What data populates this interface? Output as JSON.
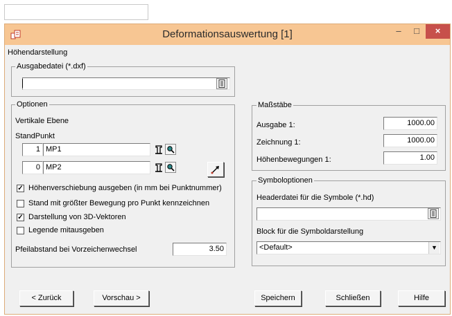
{
  "window": {
    "title": "Deformationsauswertung [1]",
    "subtitle": "Höhendarstellung",
    "accent_color": "#f7c693",
    "close_color": "#c7504b"
  },
  "output_file": {
    "legend": "Ausgabedatei (*.dxf)",
    "value": ""
  },
  "options": {
    "legend": "Optionen",
    "plane_label": "Vertikale Ebene",
    "standpoint_label": "StandPunkt",
    "points": [
      {
        "number": "1",
        "name": "MP1"
      },
      {
        "number": "0",
        "name": "MP2"
      }
    ],
    "checkboxes": [
      {
        "label": "Höhenverschiebung ausgeben (in mm bei Punktnummer)",
        "checked": true
      },
      {
        "label": "Stand mit größter Bewegung pro Punkt kennzeichnen",
        "checked": false
      },
      {
        "label": "Darstellung von 3D-Vektoren",
        "checked": true
      },
      {
        "label": "Legende mitausgeben",
        "checked": false
      }
    ],
    "arrow_label": "Pfeilabstand bei Vorzeichenwechsel",
    "arrow_value": "3.50"
  },
  "scales": {
    "legend": "Maßstäbe",
    "rows": [
      {
        "label": "Ausgabe 1:",
        "value": "1000.00"
      },
      {
        "label": "Zeichnung 1:",
        "value": "1000.00"
      },
      {
        "label": "Höhenbewegungen 1:",
        "value": "1.00"
      }
    ]
  },
  "symbols": {
    "legend": "Symboloptionen",
    "header_label": "Headerdatei für die Symbole (*.hd)",
    "header_value": "",
    "block_label": "Block für die Symboldarstellung",
    "block_value": "<Default>"
  },
  "buttons": {
    "back": "< Zurück",
    "preview": "Vorschau >",
    "save": "Speichern",
    "close": "Schließen",
    "help": "Hilfe"
  },
  "titlebar_buttons": {
    "minimize": "–",
    "maximize": "□",
    "close": "×"
  }
}
